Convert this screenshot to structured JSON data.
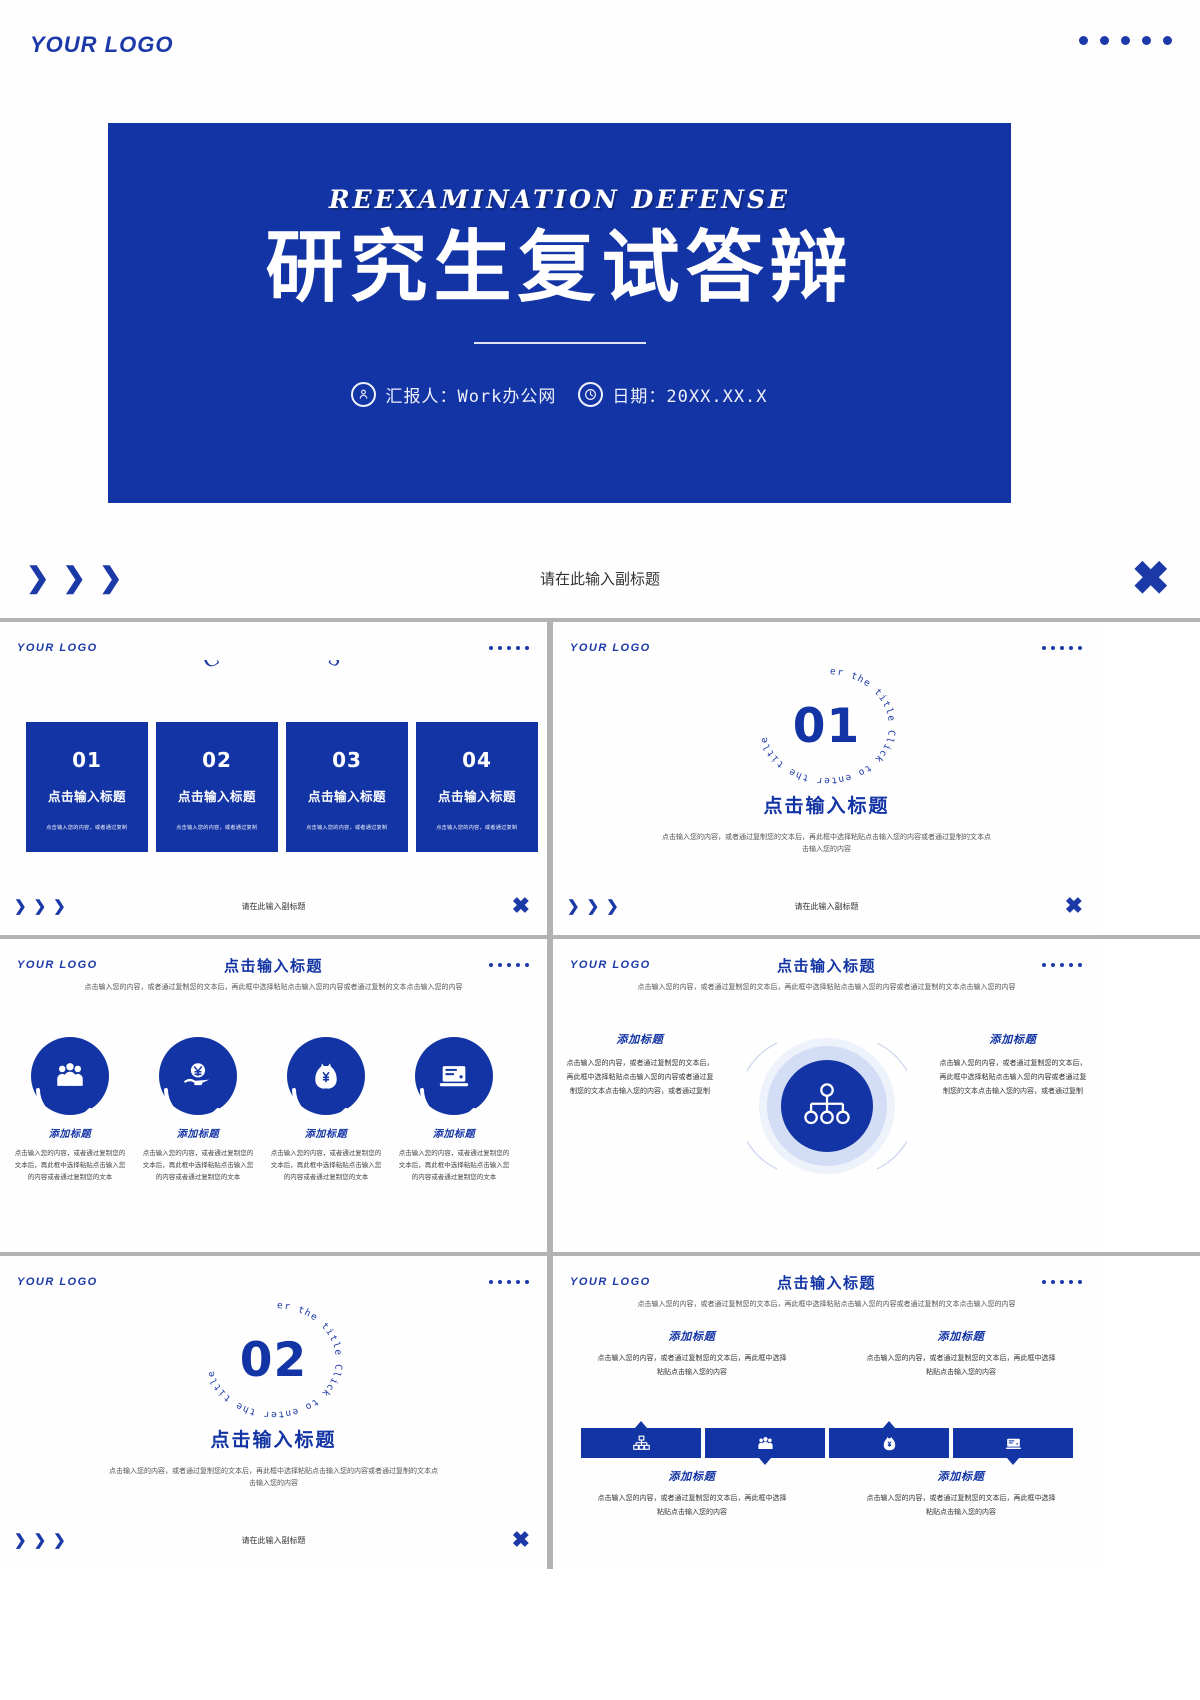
{
  "brand": {
    "logo": "YOUR LOGO",
    "accent": "#1334a4",
    "accent_dark": "#1c39a8",
    "panel_bg": "#1334a4",
    "page_bg": "#ffffff",
    "separator": "#b3b3b3"
  },
  "hero": {
    "logo": "YOUR LOGO",
    "english_title": "REEXAMINATION  DEFENSE",
    "chinese_title": "研究生复试答辩",
    "presenter_label": "汇报人：Work办公网",
    "date_label": "日期：20XX.XX.X",
    "presenter_icon": "user-icon",
    "date_icon": "clock-icon",
    "footer_subtitle": "请在此输入副标题",
    "footer_chevrons": [
      "❯",
      "❯",
      "❯"
    ],
    "footer_close_icon": "✖",
    "header_dots": 5
  },
  "contents": {
    "logo": "YOUR LOGO",
    "heading": "CONTENTS",
    "footer_subtitle": "请在此输入副标题",
    "cards": [
      {
        "num": "01",
        "title": "点击输入标题",
        "desc": "点击输入您的内容，或者通过复制"
      },
      {
        "num": "02",
        "title": "点击输入标题",
        "desc": "点击输入您的内容，或者通过复制"
      },
      {
        "num": "03",
        "title": "点击输入标题",
        "desc": "点击输入您的内容，或者通过复制"
      },
      {
        "num": "04",
        "title": "点击输入标题",
        "desc": "点击输入您的内容，或者通过复制"
      }
    ]
  },
  "divider_one": {
    "logo": "YOUR LOGO",
    "number": "01",
    "ring_text": "Click to enter the title Click to enter the title",
    "title": "点击输入标题",
    "desc": "点击输入您的内容，或者通过复制您的文本后，再此框中选择粘贴点击输入您的内容或者通过复制的文本点击输入您的内容",
    "footer_subtitle": "请在此输入副标题"
  },
  "divider_two": {
    "logo": "YOUR LOGO",
    "number": "02",
    "ring_text": "Click to enter the title Click to enter the title",
    "title": "点击输入标题",
    "desc": "点击输入您的内容，或者通过复制您的文本后，再此框中选择粘贴点击输入您的内容或者通过复制的文本点击输入您的内容",
    "footer_subtitle": "请在此输入副标题"
  },
  "icons_slide": {
    "logo": "YOUR LOGO",
    "title": "点击输入标题",
    "subtitle": "点击输入您的内容，或者通过复制您的文本后，再此框中选择粘贴点击输入您的内容或者通过复制的文本点击输入您的内容",
    "items": [
      {
        "icon": "team-people-icon",
        "label": "添加标题",
        "body": "点击输入您的内容，或者通过复制您的文本后，再此框中选择粘贴点击输入您的内容或者通过复制您的文本"
      },
      {
        "icon": "hand-yen-icon",
        "label": "添加标题",
        "body": "点击输入您的内容，或者通过复制您的文本后，再此框中选择粘贴点击输入您的内容或者通过复制您的文本"
      },
      {
        "icon": "money-bag-icon",
        "label": "添加标题",
        "body": "点击输入您的内容，或者通过复制您的文本后，再此框中选择粘贴点击输入您的内容或者通过复制您的文本"
      },
      {
        "icon": "laptop-icon",
        "label": "添加标题",
        "body": "点击输入您的内容，或者通过复制您的文本后，再此框中选择粘贴点击输入您的内容或者通过复制您的文本"
      }
    ]
  },
  "globe_slide": {
    "logo": "YOUR LOGO",
    "title": "点击输入标题",
    "subtitle": "点击输入您的内容，或者通过复制您的文本后，再此框中选择粘贴点击输入您的内容或者通过复制的文本点击输入您的内容",
    "center_icon": "org-chart-icon",
    "left": {
      "title": "添加标题",
      "body": "点击输入您的内容，或者通过复制您的文本后，再此框中选择粘贴点击输入您的内容或者通过复制您的文本点击输入您的内容，或者通过复制"
    },
    "right": {
      "title": "添加标题",
      "body": "点击输入您的内容，或者通过复制您的文本后，再此框中选择粘贴点击输入您的内容或者通过复制您的文本点击输入您的内容，或者通过复制"
    }
  },
  "tabs_slide": {
    "logo": "YOUR LOGO",
    "title": "点击输入标题",
    "subtitle": "点击输入您的内容，或者通过复制您的文本后，再此框中选择粘贴点击输入您的内容或者通过复制的文本点击输入您的内容",
    "top_blocks": [
      {
        "title": "添加标题",
        "body": "点击输入您的内容，或者通过复制您的文本后，再此框中选择粘贴点击输入您的内容"
      },
      {
        "title": "添加标题",
        "body": "点击输入您的内容，或者通过复制您的文本后，再此框中选择粘贴点击输入您的内容"
      }
    ],
    "bottom_blocks": [
      {
        "title": "添加标题",
        "body": "点击输入您的内容，或者通过复制您的文本后，再此框中选择粘贴点击输入您的内容"
      },
      {
        "title": "添加标题",
        "body": "点击输入您的内容，或者通过复制您的文本后，再此框中选择粘贴点击输入您的内容"
      }
    ],
    "tabs": [
      {
        "icon": "org-chart-icon"
      },
      {
        "icon": "team-people-icon"
      },
      {
        "icon": "money-bag-icon"
      },
      {
        "icon": "laptop-icon"
      }
    ]
  }
}
